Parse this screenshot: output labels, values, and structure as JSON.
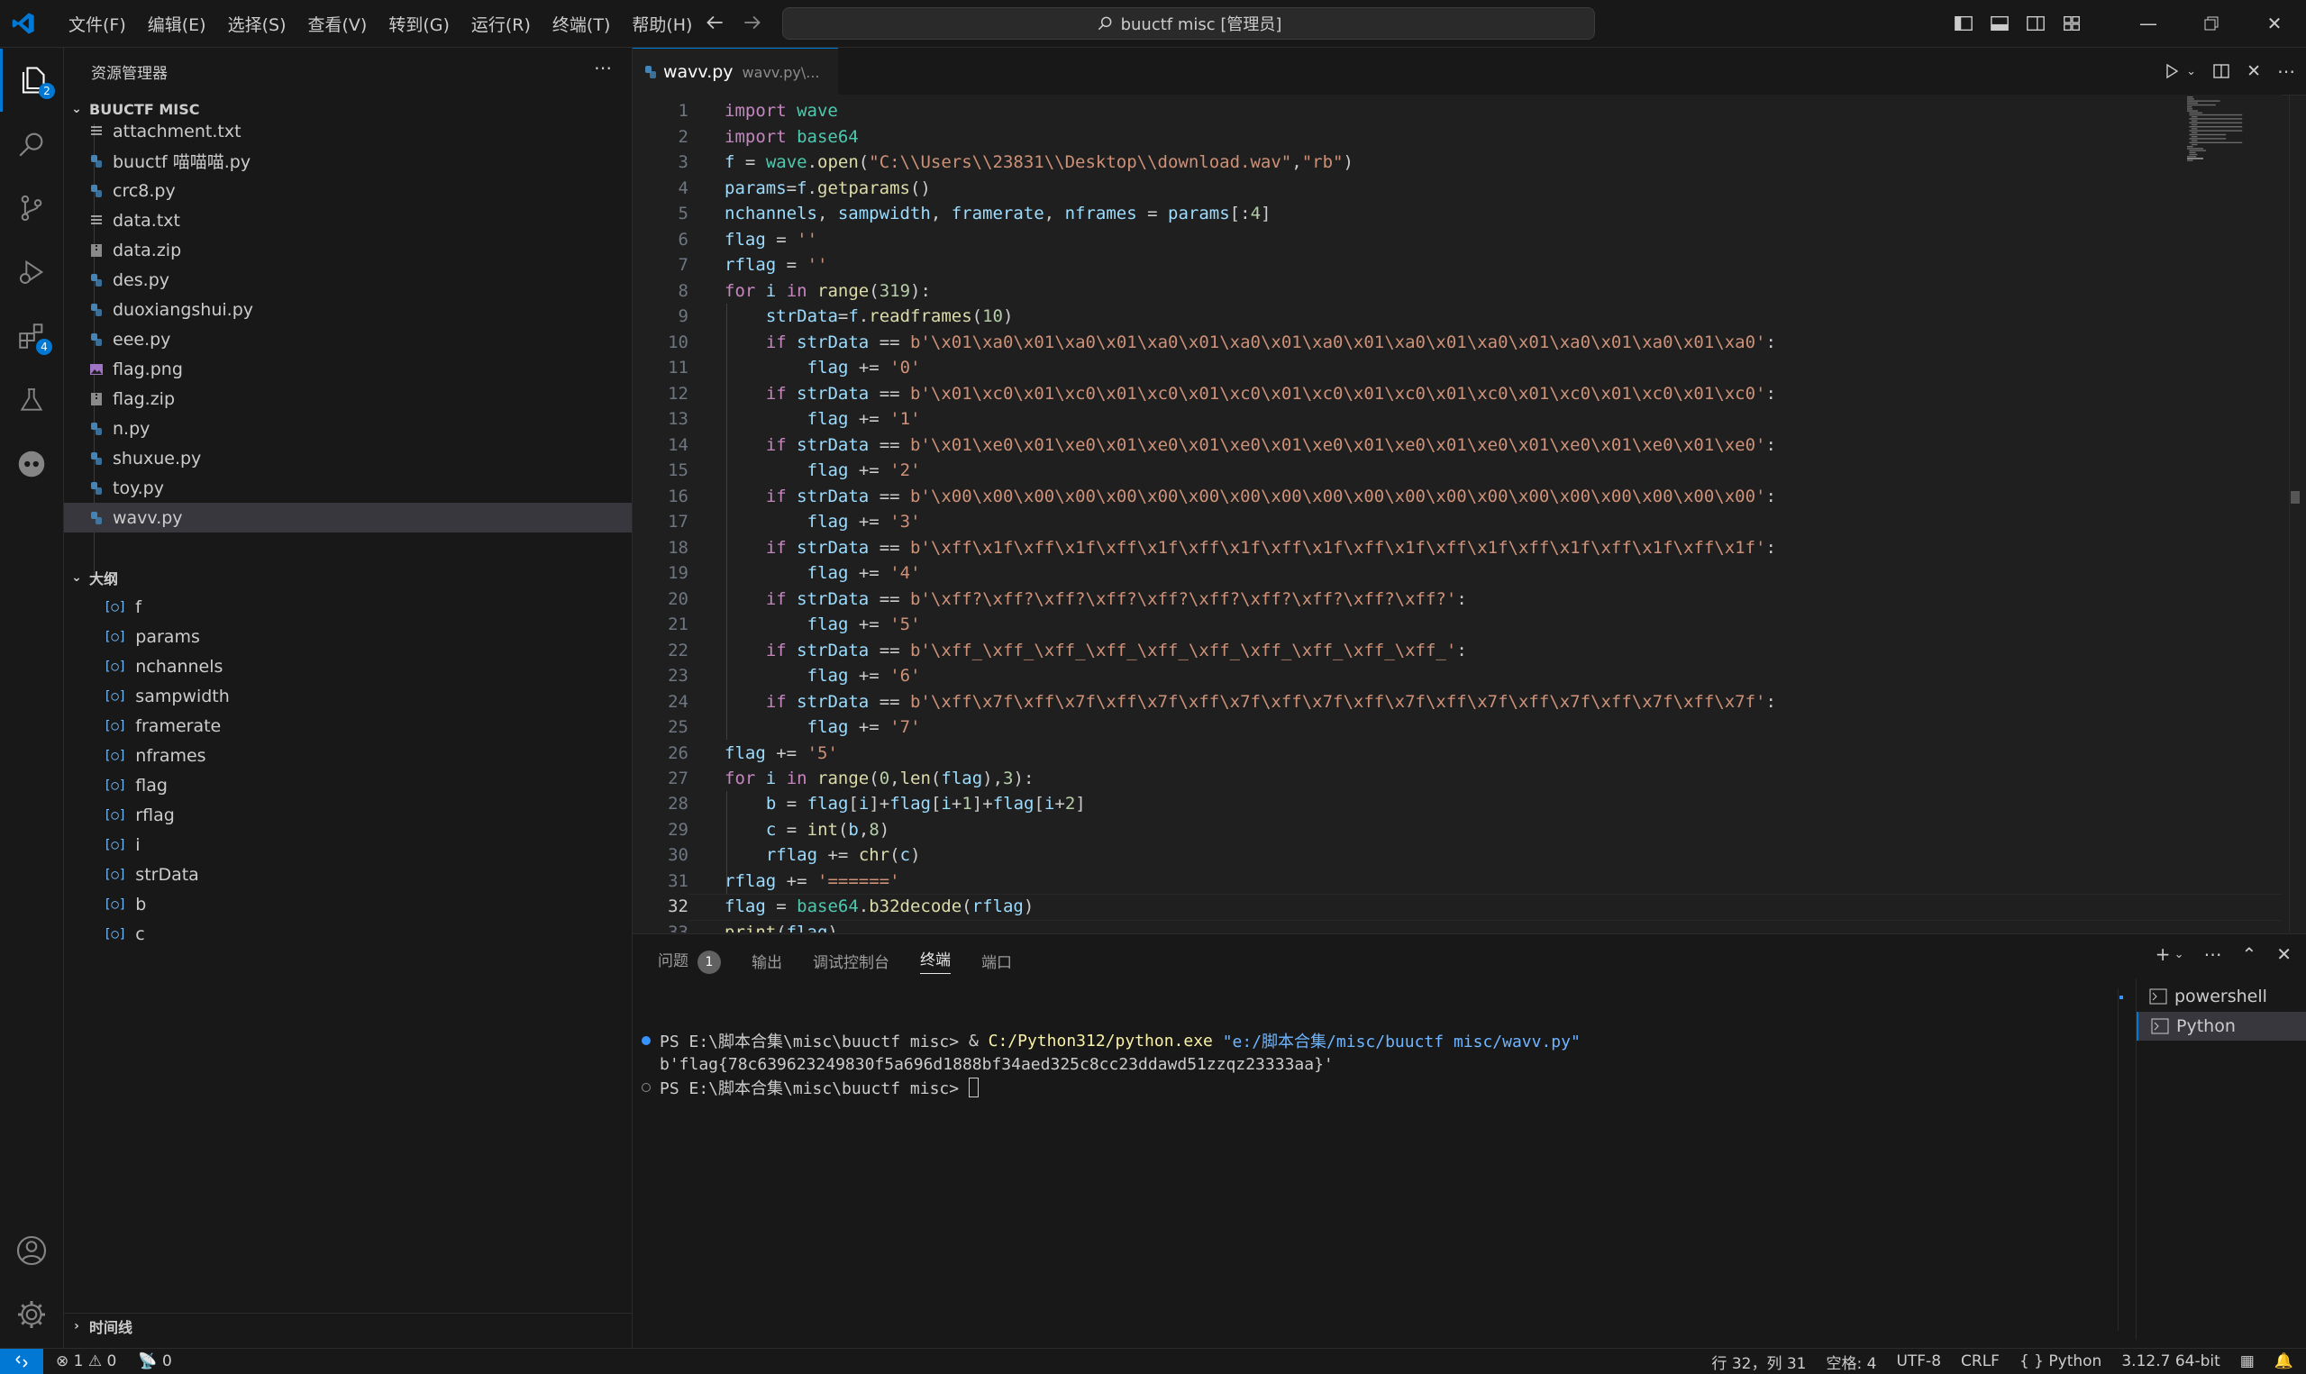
{
  "menu": [
    "文件(F)",
    "编辑(E)",
    "选择(S)",
    "查看(V)",
    "转到(G)",
    "运行(R)",
    "终端(T)",
    "帮助(H)"
  ],
  "command_center": "buuctf misc [管理员]",
  "activity": {
    "explorer_badge": "2",
    "extensions_badge": "4"
  },
  "sidebar": {
    "title": "资源管理器",
    "folder": "BUUCTF MISC",
    "files": [
      {
        "name": "attachment.txt",
        "icon": "text-file-icon"
      },
      {
        "name": "buuctf 喵喵喵.py",
        "icon": "python-file-icon"
      },
      {
        "name": "crc8.py",
        "icon": "python-file-icon"
      },
      {
        "name": "data.txt",
        "icon": "text-file-icon"
      },
      {
        "name": "data.zip",
        "icon": "zip-file-icon"
      },
      {
        "name": "des.py",
        "icon": "python-file-icon"
      },
      {
        "name": "duoxiangshui.py",
        "icon": "python-file-icon"
      },
      {
        "name": "eee.py",
        "icon": "python-file-icon"
      },
      {
        "name": "flag.png",
        "icon": "image-file-icon"
      },
      {
        "name": "flag.zip",
        "icon": "zip-file-icon"
      },
      {
        "name": "n.py",
        "icon": "python-file-icon"
      },
      {
        "name": "shuxue.py",
        "icon": "python-file-icon"
      },
      {
        "name": "toy.py",
        "icon": "python-file-icon"
      },
      {
        "name": "wavv.py",
        "icon": "python-file-icon"
      }
    ],
    "outline_title": "大纲",
    "outline": [
      "f",
      "params",
      "nchannels",
      "sampwidth",
      "framerate",
      "nframes",
      "flag",
      "rflag",
      "i",
      "strData",
      "b",
      "c"
    ],
    "timeline_title": "时间线"
  },
  "editor": {
    "tab_name": "wavv.py",
    "tab_path": "wavv.py\\...",
    "current_line": 32,
    "lines": [
      "import wave",
      "import base64",
      "f = wave.open(\"C:\\\\Users\\\\23831\\\\Desktop\\\\download.wav\",\"rb\")",
      "params=f.getparams()",
      "nchannels, sampwidth, framerate, nframes = params[:4]",
      "flag = ''",
      "rflag = ''",
      "for i in range(319):",
      "    strData=f.readframes(10)",
      "    if strData == b'\\x01\\xa0\\x01\\xa0\\x01\\xa0\\x01\\xa0\\x01\\xa0\\x01\\xa0\\x01\\xa0\\x01\\xa0\\x01\\xa0\\x01\\xa0':",
      "        flag += '0'",
      "    if strData == b'\\x01\\xc0\\x01\\xc0\\x01\\xc0\\x01\\xc0\\x01\\xc0\\x01\\xc0\\x01\\xc0\\x01\\xc0\\x01\\xc0\\x01\\xc0':",
      "        flag += '1'",
      "    if strData == b'\\x01\\xe0\\x01\\xe0\\x01\\xe0\\x01\\xe0\\x01\\xe0\\x01\\xe0\\x01\\xe0\\x01\\xe0\\x01\\xe0\\x01\\xe0':",
      "        flag += '2'",
      "    if strData == b'\\x00\\x00\\x00\\x00\\x00\\x00\\x00\\x00\\x00\\x00\\x00\\x00\\x00\\x00\\x00\\x00\\x00\\x00\\x00\\x00':",
      "        flag += '3'",
      "    if strData == b'\\xff\\x1f\\xff\\x1f\\xff\\x1f\\xff\\x1f\\xff\\x1f\\xff\\x1f\\xff\\x1f\\xff\\x1f\\xff\\x1f\\xff\\x1f':",
      "        flag += '4'",
      "    if strData == b'\\xff?\\xff?\\xff?\\xff?\\xff?\\xff?\\xff?\\xff?\\xff?\\xff?':",
      "        flag += '5'",
      "    if strData == b'\\xff_\\xff_\\xff_\\xff_\\xff_\\xff_\\xff_\\xff_\\xff_\\xff_':",
      "        flag += '6'",
      "    if strData == b'\\xff\\x7f\\xff\\x7f\\xff\\x7f\\xff\\x7f\\xff\\x7f\\xff\\x7f\\xff\\x7f\\xff\\x7f\\xff\\x7f\\xff\\x7f':",
      "        flag += '7'",
      "flag += '5'",
      "for i in range(0,len(flag),3):",
      "    b = flag[i]+flag[i+1]+flag[i+2]",
      "    c = int(b,8)",
      "    rflag += chr(c)",
      "rflag += '======'",
      "flag = base64.b32decode(rflag)",
      "print(flag)"
    ]
  },
  "panel": {
    "tabs": [
      "问题",
      "输出",
      "调试控制台",
      "终端",
      "端口"
    ],
    "problems_count": "1",
    "active_tab": "终端",
    "terminal": {
      "prompt1": "PS E:\\脚本合集\\misc\\buuctf misc> ",
      "cmd_amp": "& ",
      "cmd_exe": "C:/Python312/python.exe",
      "cmd_arg": " \"e:/脚本合集/misc/buuctf misc/wavv.py\"",
      "output": "b'flag{78c639623249830f5a696d1888bf34aed325c8cc23ddawd51zzqz23333aa}'",
      "prompt2": "PS E:\\脚本合集\\misc\\buuctf misc> "
    },
    "terminals": [
      "powershell",
      "Python"
    ]
  },
  "status": {
    "errors": "1",
    "warnings": "0",
    "ports": "0",
    "position": "行 32，列 31",
    "spaces": "空格: 4",
    "encoding": "UTF-8",
    "eol": "CRLF",
    "language": "Python",
    "interpreter": "3.12.7 64-bit"
  },
  "colors": {
    "accent": "#0078d4",
    "keyword": "#c586c0",
    "function": "#dcdcaa",
    "string": "#ce9178",
    "number": "#b5cea8",
    "variable": "#9cdcfe"
  }
}
